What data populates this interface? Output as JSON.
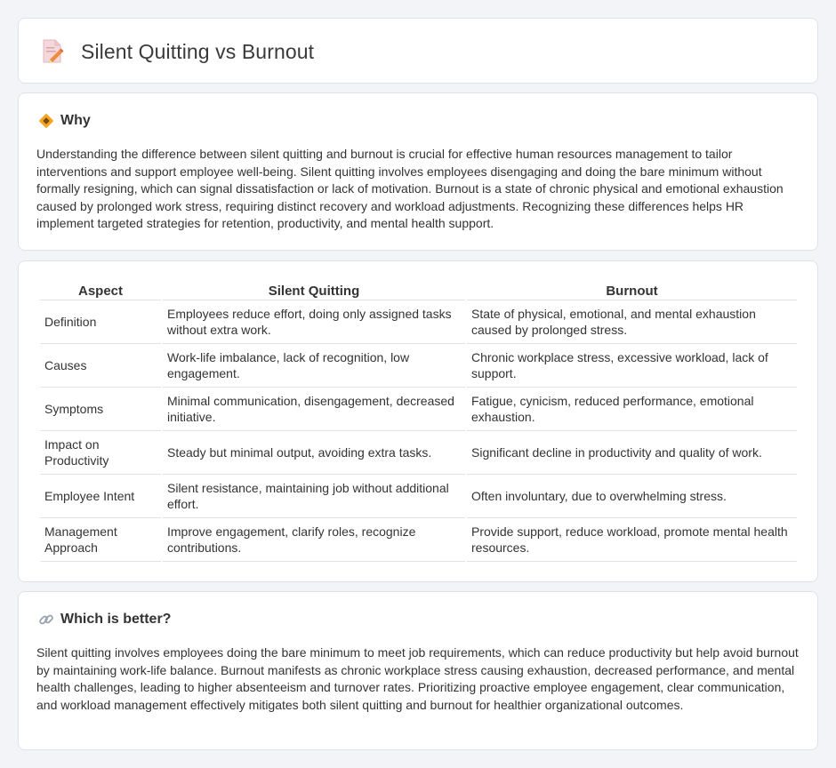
{
  "header": {
    "title": "Silent Quitting vs Burnout",
    "icon": "document-edit-icon"
  },
  "why": {
    "title": "Why",
    "icon": "diamond-sign-icon",
    "body": "Understanding the difference between silent quitting and burnout is crucial for effective human resources management to tailor interventions and support employee well-being. Silent quitting involves employees disengaging and doing the bare minimum without formally resigning, which can signal dissatisfaction or lack of motivation. Burnout is a state of chronic physical and emotional exhaustion caused by prolonged work stress, requiring distinct recovery and workload adjustments. Recognizing these differences helps HR implement targeted strategies for retention, productivity, and mental health support."
  },
  "table": {
    "headers": [
      "Aspect",
      "Silent Quitting",
      "Burnout"
    ],
    "rows": [
      [
        "Definition",
        "Employees reduce effort, doing only assigned tasks without extra work.",
        "State of physical, emotional, and mental exhaustion caused by prolonged stress."
      ],
      [
        "Causes",
        "Work-life imbalance, lack of recognition, low engagement.",
        "Chronic workplace stress, excessive workload, lack of support."
      ],
      [
        "Symptoms",
        "Minimal communication, disengagement, decreased initiative.",
        "Fatigue, cynicism, reduced performance, emotional exhaustion."
      ],
      [
        "Impact on Productivity",
        "Steady but minimal output, avoiding extra tasks.",
        "Significant decline in productivity and quality of work."
      ],
      [
        "Employee Intent",
        "Silent resistance, maintaining job without additional effort.",
        "Often involuntary, due to overwhelming stress."
      ],
      [
        "Management Approach",
        "Improve engagement, clarify roles, recognize contributions.",
        "Provide support, reduce workload, promote mental health resources."
      ]
    ]
  },
  "better": {
    "title": "Which is better?",
    "icon": "link-icon",
    "body": "Silent quitting involves employees doing the bare minimum to meet job requirements, which can reduce productivity but help avoid burnout by maintaining work-life balance. Burnout manifests as chronic workplace stress causing exhaustion, decreased performance, and mental health challenges, leading to higher absenteeism and turnover rates. Prioritizing proactive employee engagement, clear communication, and workload management effectively mitigates both silent quitting and burnout for healthier organizational outcomes."
  }
}
